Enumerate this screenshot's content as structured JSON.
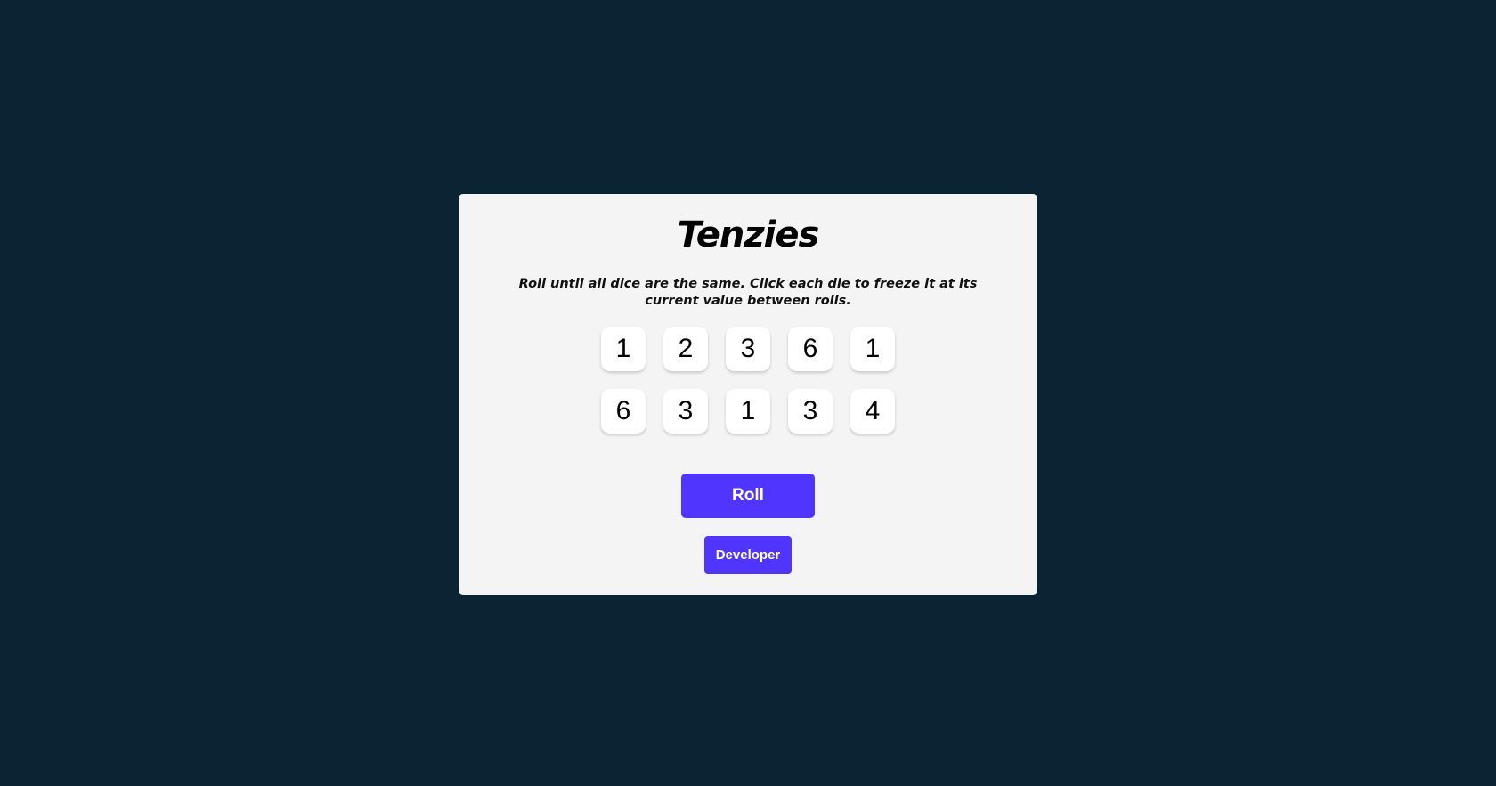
{
  "app": {
    "title": "Tenzies",
    "instructions": "Roll until all dice are the same. Click each die to freeze it at its current value between rolls."
  },
  "dice": [
    {
      "value": "1",
      "held": false
    },
    {
      "value": "2",
      "held": false
    },
    {
      "value": "3",
      "held": false
    },
    {
      "value": "6",
      "held": false
    },
    {
      "value": "1",
      "held": false
    },
    {
      "value": "6",
      "held": false
    },
    {
      "value": "3",
      "held": false
    },
    {
      "value": "1",
      "held": false
    },
    {
      "value": "3",
      "held": false
    },
    {
      "value": "4",
      "held": false
    }
  ],
  "buttons": {
    "roll_label": "Roll",
    "developer_label": "Developer"
  },
  "colors": {
    "page_background": "#0b2434",
    "card_background": "#f4f4f4",
    "die_background": "#ffffff",
    "accent": "#5035ff"
  }
}
